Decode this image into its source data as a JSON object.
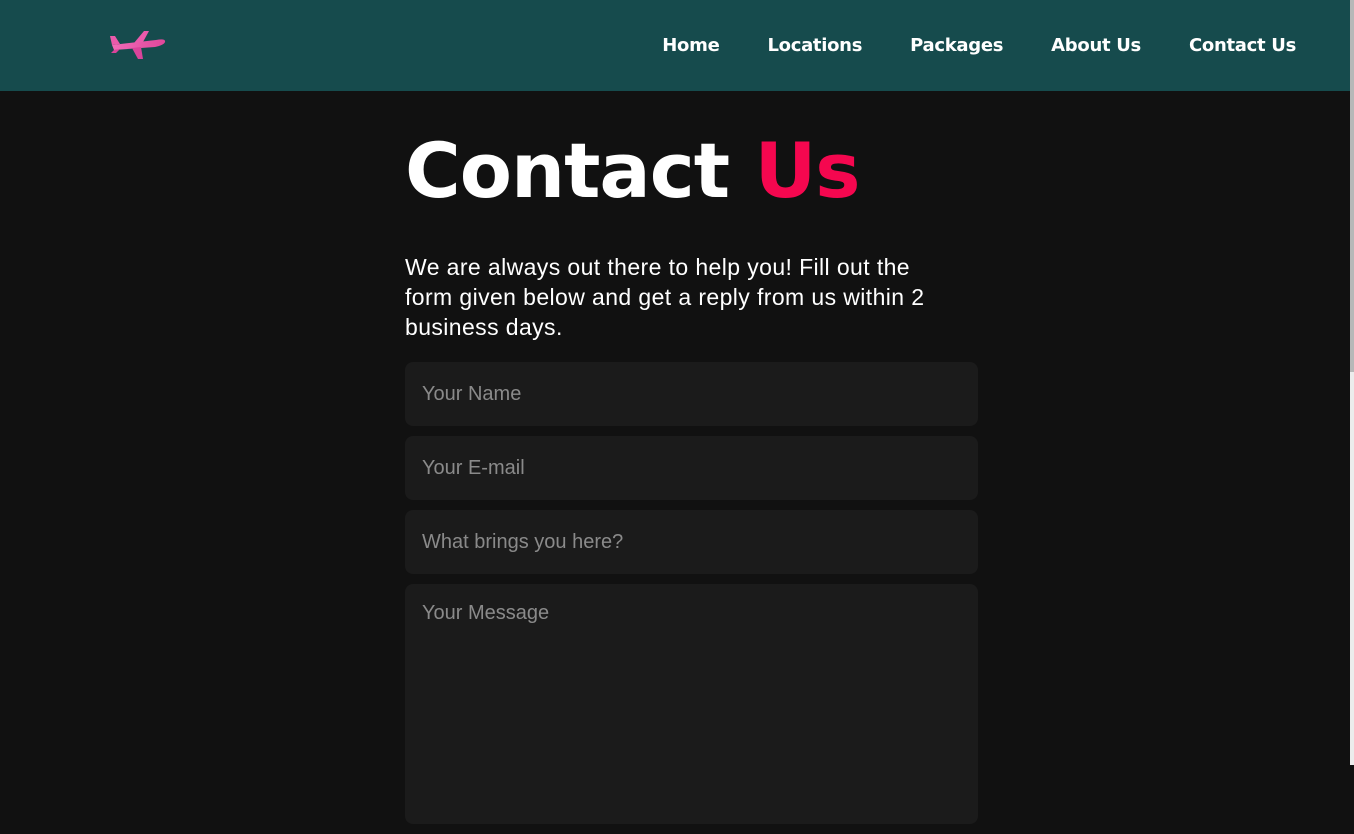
{
  "nav": {
    "logo_icon": "airplane-icon",
    "links": [
      {
        "label": "Home"
      },
      {
        "label": "Locations"
      },
      {
        "label": "Packages"
      },
      {
        "label": "About Us"
      },
      {
        "label": "Contact Us"
      }
    ]
  },
  "main": {
    "title_main": "Contact",
    "title_accent": "Us",
    "intro": "We are always out there to help you! Fill out the form given below and get a reply from us within 2 business days."
  },
  "form": {
    "name_placeholder": "Your Name",
    "email_placeholder": "Your E-mail",
    "subject_placeholder": "What brings you here?",
    "message_placeholder": "Your Message"
  },
  "colors": {
    "navbar_bg": "#164b4d",
    "page_bg": "#111111",
    "accent": "#f5074f",
    "field_bg": "#1b1b1b",
    "logo": "#e85aa8"
  }
}
